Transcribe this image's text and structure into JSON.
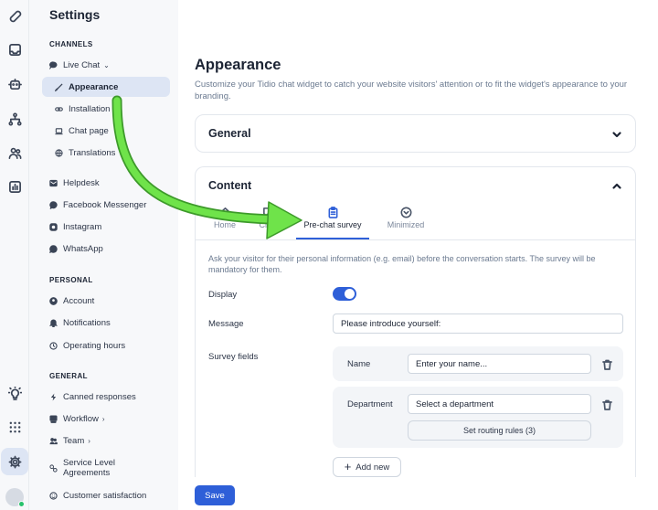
{
  "rail": {
    "icons": [
      "tidio-logo-icon",
      "inbox-icon",
      "bot-icon",
      "flows-icon",
      "contacts-icon",
      "analytics-icon",
      "lightbulb-icon",
      "apps-grid-icon",
      "settings-icon",
      "avatar"
    ]
  },
  "sidebar": {
    "title": "Settings",
    "sections": {
      "channels": "CHANNELS",
      "personal": "PERSONAL",
      "general": "GENERAL"
    },
    "items": {
      "live_chat": "Live Chat",
      "appearance": "Appearance",
      "installation": "Installation",
      "chat_page": "Chat page",
      "translations": "Translations",
      "helpdesk": "Helpdesk",
      "facebook": "Facebook Messenger",
      "instagram": "Instagram",
      "whatsapp": "WhatsApp",
      "account": "Account",
      "notifications": "Notifications",
      "operating_hours": "Operating hours",
      "canned_responses": "Canned responses",
      "workflow": "Workflow",
      "team": "Team",
      "sla_line1": "Service Level",
      "sla_line2": "Agreements",
      "customer_satisfaction": "Customer satisfaction"
    }
  },
  "main": {
    "title": "Appearance",
    "description": "Customize your Tidio chat widget to catch your website visitors' attention or to fit the widget's appearance to your branding.",
    "general_card": {
      "title": "General"
    },
    "content_card": {
      "title": "Content",
      "tabs": {
        "home": "Home",
        "chat": "Chat",
        "prechat": "Pre-chat survey",
        "minimized": "Minimized"
      },
      "survey_description": "Ask your visitor for their personal information (e.g. email) before the conversation starts. The survey will be mandatory for them.",
      "display_label": "Display",
      "display_on": true,
      "message_label": "Message",
      "message_value": "Please introduce yourself:",
      "survey_fields_label": "Survey fields",
      "fields": {
        "name_label": "Name",
        "name_placeholder": "Enter your name...",
        "department_label": "Department",
        "department_value": "Select a department",
        "routing_button": "Set routing rules (3)"
      },
      "add_new": "Add new"
    },
    "save": "Save"
  },
  "colors": {
    "accent": "#2e5fd8",
    "annotation_arrow": "#6fe34a",
    "sidebar_bg": "#f7f8fa",
    "active_item_bg": "#dde5f4"
  }
}
